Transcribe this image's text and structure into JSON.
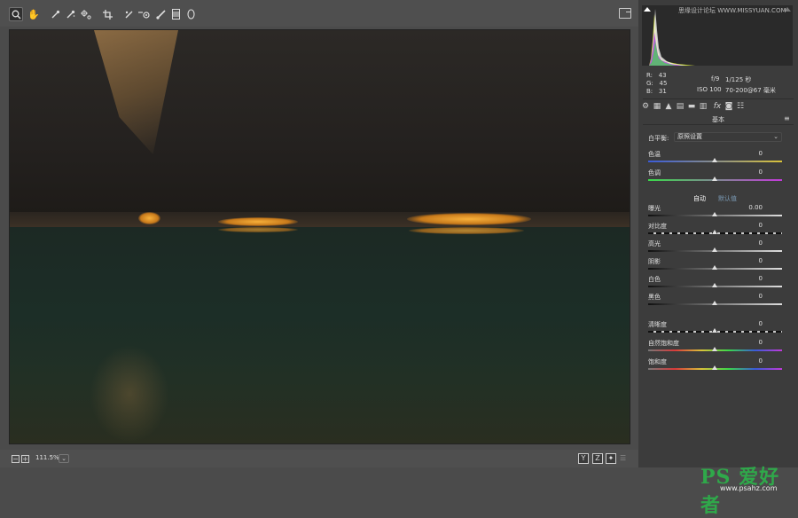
{
  "toolbar": {
    "tools": [
      "zoom-icon",
      "hand-icon",
      "white-balance-icon",
      "color-sampler-icon",
      "target-adjust-icon",
      "crop-icon",
      "straighten-icon",
      "red-eye-icon",
      "adjust-brush-icon",
      "graduated-filter-icon",
      "radial-filter-icon"
    ]
  },
  "status": {
    "zoom": "111.5%",
    "zoom_dropdown": "⌄",
    "view_buttons": [
      "Y",
      "Z",
      "✦"
    ]
  },
  "histogram": {
    "watermark": "思缘设计论坛 WWW.MISSYUAN.COM"
  },
  "info": {
    "r_label": "R:",
    "r_value": "43",
    "g_label": "G:",
    "g_value": "45",
    "b_label": "B:",
    "b_value": "31",
    "aperture": "f/9",
    "shutter": "1/125 秒",
    "iso": "ISO 100",
    "lens": "70-200@67 毫米"
  },
  "panel": {
    "section_title": "基本",
    "wb_label": "白平衡:",
    "wb_value": "原照设置",
    "auto_label": "自动",
    "default_label": "默认值",
    "sliders": {
      "temp": {
        "label": "色温",
        "value": "0"
      },
      "tint": {
        "label": "色调",
        "value": "0"
      },
      "exposure": {
        "label": "曝光",
        "value": "0.00"
      },
      "contrast": {
        "label": "对比度",
        "value": "0"
      },
      "highlights": {
        "label": "高光",
        "value": "0"
      },
      "shadows": {
        "label": "阴影",
        "value": "0"
      },
      "whites": {
        "label": "白色",
        "value": "0"
      },
      "blacks": {
        "label": "黑色",
        "value": "0"
      },
      "clarity": {
        "label": "清晰度",
        "value": "0"
      },
      "vibrance": {
        "label": "自然饱和度",
        "value": "0"
      },
      "saturation": {
        "label": "饱和度",
        "value": "0"
      }
    }
  },
  "colors": {
    "temp_track_start": "#3a5bd9",
    "temp_track_end": "#d9c23a",
    "tint_track_start": "#3ad94a",
    "tint_track_end": "#c23ad9",
    "auto_color": "#ffffff",
    "default_color": "#7a9ab5"
  },
  "brand": {
    "ps_logo": "PS 爱好者",
    "ps_url": "www.psahz.com"
  }
}
